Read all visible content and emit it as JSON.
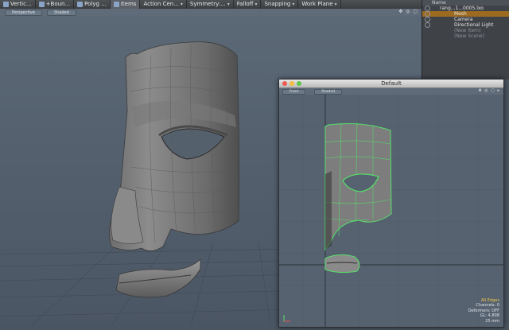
{
  "toolbar": {
    "items": [
      "Vertic...",
      "+Boun...",
      "Polyg ...",
      "Items",
      "Action Cen...",
      "Symmetry:...",
      "Falloff",
      "Snapping",
      "Work Plane"
    ],
    "selected_index": 3
  },
  "main_viewport": {
    "tabs": [
      "Perspective",
      "Shaded"
    ],
    "header_icons": "✥ ◎ ▢"
  },
  "outliner": {
    "header": "Name",
    "rows": [
      {
        "label": "rang...1...0005.lxo",
        "state": "normal"
      },
      {
        "label": "Mesh",
        "state": "selected"
      },
      {
        "label": "Camera",
        "state": "normal"
      },
      {
        "label": "Directional Light",
        "state": "normal"
      },
      {
        "label": "(New Item)",
        "state": "dim"
      },
      {
        "label": "(New Scene)",
        "state": "dim"
      }
    ]
  },
  "window": {
    "title": "Default",
    "tabs": [
      "Front",
      "Shaded"
    ],
    "header_icons": "✥ ◎ ▢ ▸",
    "traffic_colors": [
      "#ee5a52",
      "#f3be3d",
      "#5fc74a"
    ]
  },
  "status": {
    "mode": "All Edges",
    "channels": "Channels: 0",
    "deformers": "Deformers: OFF",
    "gl": "GL: 4,808",
    "scale": "25 mm"
  },
  "colors": {
    "wire_selected": "#56e06a",
    "accent_selected": "#9d6b1f"
  }
}
